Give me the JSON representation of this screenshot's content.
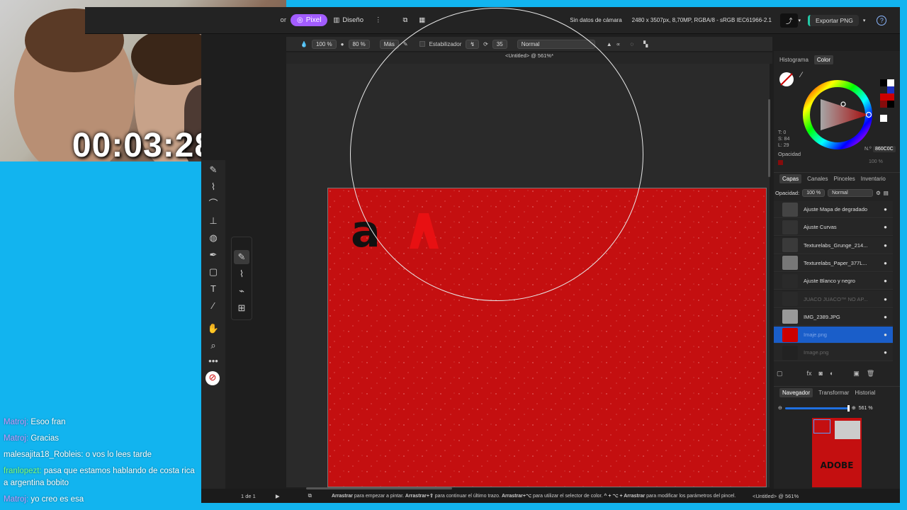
{
  "overlay": {
    "timer": "00:03:28",
    "chat": [
      {
        "user": "Matroj:",
        "text": "Esoo fran",
        "color": "#c89bff"
      },
      {
        "user": "Matroj:",
        "text": "Gracias",
        "color": "#c89bff"
      },
      {
        "user": "malesajita18_Robleis:",
        "text": "o vos lo lees tarde",
        "color": "#ffffff"
      },
      {
        "user": "franlopezt:",
        "text": "pasa que estamos hablando de costa rica a argentina bobito",
        "color": "#7dff7d"
      },
      {
        "user": "Matroj:",
        "text": "yo creo es esa",
        "color": "#c89bff"
      }
    ]
  },
  "topbar": {
    "partial_left": "or",
    "pixel_label": "Pixel",
    "design_label": "Diseño",
    "camera_info": "Sin datos de cámara",
    "doc_info": "2480 x 3507px, 8,70MP, RGBA/8 - sRGB IEC61966-2.1",
    "export_label": "Exportar PNG"
  },
  "context": {
    "flow": "100 %",
    "opacity": "80 %",
    "more": "Más",
    "stabilizer": "Estabilizador",
    "stab_value": "35",
    "blend": "Normal"
  },
  "document": {
    "title": "<Untitled> @ 561%*"
  },
  "color_panel": {
    "tabs": [
      "Histograma",
      "Color"
    ],
    "active": "Color",
    "t": "T: 0",
    "s": "S: 84",
    "l": "L: 29",
    "opacity_label": "Opacidad",
    "opacity_value": "100 %",
    "hex_label": "N.º",
    "hex": "860C0C"
  },
  "layers_panel": {
    "tabs": [
      "Capas",
      "Canales",
      "Pinceles",
      "Inventario"
    ],
    "active": "Capas",
    "opacity_label": "Opacidad:",
    "opacity_value": "100 %",
    "blend": "Normal",
    "layers": [
      {
        "name": "Ajuste Mapa de degradado"
      },
      {
        "name": "Ajuste Curvas"
      },
      {
        "name": "Texturelabs_Grunge_214..."
      },
      {
        "name": "Texturelabs_Paper_377L..."
      },
      {
        "name": "Ajuste Blanco y negro"
      },
      {
        "name": "JUACO JUACO™ NO AP..."
      },
      {
        "name": "IMG_2389.JPG"
      },
      {
        "name": "Imaje.png"
      },
      {
        "name": "Image.png"
      }
    ]
  },
  "navigator": {
    "tabs": [
      "Navegador",
      "Transformar",
      "Historial"
    ],
    "active": "Navegador",
    "zoom": "561 %",
    "preview_text": "ADOBE"
  },
  "status": {
    "page": "1 de 1",
    "hint_b1": "Arrastrar",
    "hint_t1": " para empezar a pintar. ",
    "hint_b2": "Arrastrar+⇧",
    "hint_t2": " para continuar el último trazo. ",
    "hint_b3": "Arrastrar+⌥",
    "hint_t3": " para utilizar el selector de color. ",
    "hint_b4": "^ + ⌥ + Arrastrar",
    "hint_t4": " para modificar los parámetros del pincel.",
    "doc": "<Untitled> @ 561%"
  },
  "colors": {
    "accent_purple": "#a25cff",
    "doc_red": "#c40f10",
    "selection_blue": "#1a5ec9",
    "export_teal": "#23c9a7"
  }
}
